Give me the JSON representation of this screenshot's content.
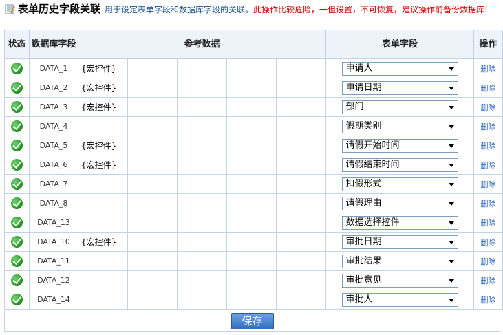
{
  "header": {
    "title": "表单历史字段关联",
    "description": "用于设定表单字段和数据库字段的关联。",
    "warning": "此操作比较危险，一但设置，不可恢复，建议操作前备份数据库!"
  },
  "table": {
    "columns": {
      "status": "状态",
      "db_field": "数据库字段",
      "reference": "参考数据",
      "form_field": "表单字段",
      "action": "操作"
    },
    "rows": [
      {
        "status": "ok",
        "db_field": "DATA_1",
        "ref": "{宏控件}",
        "form_field": "申请人",
        "action": "删除"
      },
      {
        "status": "ok",
        "db_field": "DATA_2",
        "ref": "{宏控件}",
        "form_field": "申请日期",
        "action": "删除"
      },
      {
        "status": "ok",
        "db_field": "DATA_3",
        "ref": "{宏控件}",
        "form_field": "部门",
        "action": "删除"
      },
      {
        "status": "ok",
        "db_field": "DATA_4",
        "ref": "",
        "form_field": "假期类别",
        "action": "删除"
      },
      {
        "status": "ok",
        "db_field": "DATA_5",
        "ref": "{宏控件}",
        "form_field": "请假开始时间",
        "action": "删除"
      },
      {
        "status": "ok",
        "db_field": "DATA_6",
        "ref": "{宏控件}",
        "form_field": "请假结束时间",
        "action": "删除"
      },
      {
        "status": "ok",
        "db_field": "DATA_7",
        "ref": "",
        "form_field": "扣假形式",
        "action": "删除"
      },
      {
        "status": "ok",
        "db_field": "DATA_8",
        "ref": "",
        "form_field": "请假理由",
        "action": "删除"
      },
      {
        "status": "ok",
        "db_field": "DATA_13",
        "ref": "",
        "form_field": "数据选择控件",
        "action": "删除"
      },
      {
        "status": "ok",
        "db_field": "DATA_10",
        "ref": "{宏控件}",
        "form_field": "审批日期",
        "action": "删除"
      },
      {
        "status": "ok",
        "db_field": "DATA_11",
        "ref": "",
        "form_field": "审批结果",
        "action": "删除"
      },
      {
        "status": "ok",
        "db_field": "DATA_12",
        "ref": "",
        "form_field": "审批意见",
        "action": "删除"
      },
      {
        "status": "ok",
        "db_field": "DATA_14",
        "ref": "",
        "form_field": "审批人",
        "action": "删除"
      }
    ]
  },
  "footer": {
    "save_label": "保存"
  },
  "icons": {
    "header_icon": "edit-form-icon",
    "status_icon": "check-circle-icon",
    "dropdown_icon": "chevron-down-icon"
  },
  "colors": {
    "title": "#000000",
    "description": "#14508a",
    "warning": "#d40000",
    "link": "#1f5fbf",
    "status_ok": "#1d8b1d",
    "header_bg": "#eef3f9",
    "border": "#c3d3e3",
    "save_button": "#2f6fc0"
  }
}
